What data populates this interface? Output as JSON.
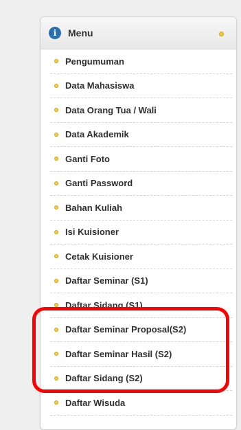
{
  "menu": {
    "title": "Menu",
    "items": [
      {
        "label": "Pengumuman"
      },
      {
        "label": "Data Mahasiswa"
      },
      {
        "label": "Data Orang Tua / Wali"
      },
      {
        "label": "Data Akademik"
      },
      {
        "label": "Ganti Foto"
      },
      {
        "label": "Ganti Password"
      },
      {
        "label": "Bahan Kuliah"
      },
      {
        "label": "Isi Kuisioner"
      },
      {
        "label": "Cetak Kuisioner"
      },
      {
        "label": "Daftar Seminar (S1)"
      },
      {
        "label": "Daftar Sidang (S1)"
      },
      {
        "label": "Daftar Seminar Proposal(S2)"
      },
      {
        "label": "Daftar Seminar Hasil (S2)"
      },
      {
        "label": "Daftar Sidang (S2)"
      },
      {
        "label": "Daftar Wisuda"
      }
    ]
  },
  "colors": {
    "bullet": "#f3cc47",
    "info_icon": "#2a6fb0",
    "highlight": "#ff0000"
  }
}
